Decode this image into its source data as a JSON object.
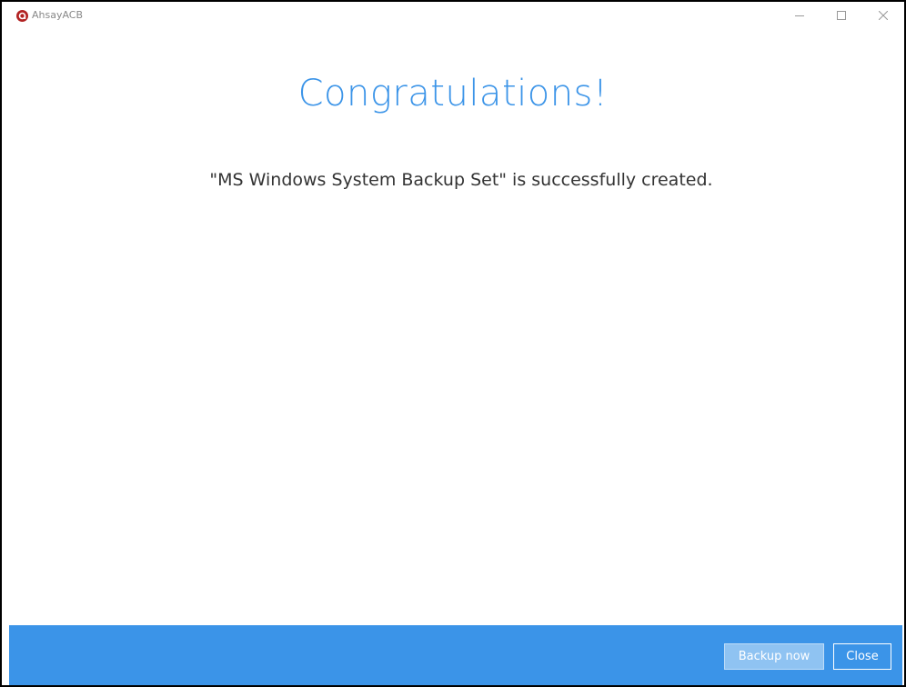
{
  "window": {
    "title": "AhsayACB",
    "controls": {
      "minimize": "—",
      "maximize": "☐",
      "close": "✕"
    }
  },
  "main": {
    "heading": "Congratulations!",
    "message": "\"MS Windows System Backup Set\" is successfully created."
  },
  "footer": {
    "backup_now_label": "Backup now",
    "close_label": "Close"
  },
  "colors": {
    "accent": "#3B94E8",
    "logo": "#B22222",
    "button_disabled": "#8FC3F2"
  }
}
